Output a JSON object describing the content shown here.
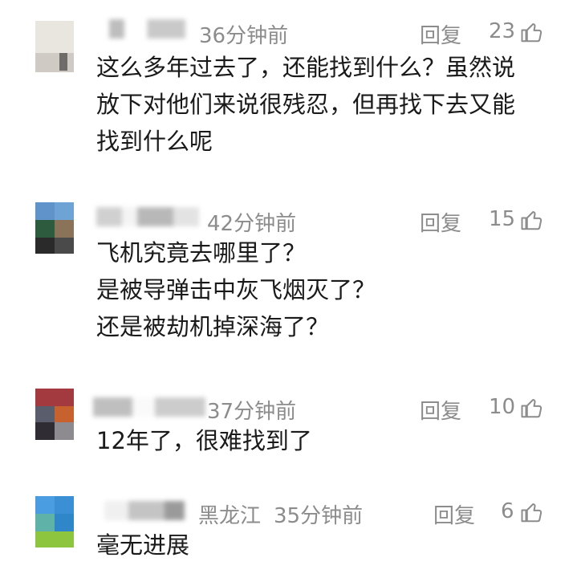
{
  "comments": [
    {
      "time": "36分钟前",
      "location": "",
      "reply_label": "回复",
      "likes": "23",
      "lines": [
        "这么多年过去了，还能找到什么？虽然说",
        "放下对他们来说很残忍，但再找下去又能",
        "找到什么呢"
      ],
      "avatar_colors": [
        "#e7e3de",
        "#d9d6d2",
        "#8a8785",
        "#cfcac5"
      ]
    },
    {
      "time": "42分钟前",
      "location": "",
      "reply_label": "回复",
      "likes": "15",
      "lines": [
        "飞机究竟去哪里了？",
        "是被导弹击中灰飞烟灭了？",
        "还是被劫机掉深海了？"
      ],
      "avatar_colors": [
        "#5f93c9",
        "#2d5b3d",
        "#8a7358",
        "#2a2a2a"
      ]
    },
    {
      "time": "37分钟前",
      "location": "",
      "reply_label": "回复",
      "likes": "10",
      "lines": [
        "12年了，很难找到了"
      ],
      "avatar_colors": [
        "#a23a3f",
        "#5a5d6c",
        "#c7622f",
        "#2f2c33"
      ]
    },
    {
      "time": "35分钟前",
      "location": "黑龙江",
      "reply_label": "回复",
      "likes": "6",
      "lines": [
        "毫无进展"
      ],
      "avatar_colors": [
        "#4a9de0",
        "#2f86c9",
        "#8ec53e",
        "#5fb2a8"
      ]
    }
  ],
  "colors": {
    "meta": "#8c8c8c",
    "text": "#1a1a1a"
  },
  "icons": {
    "like": "thumbs-up-icon"
  }
}
